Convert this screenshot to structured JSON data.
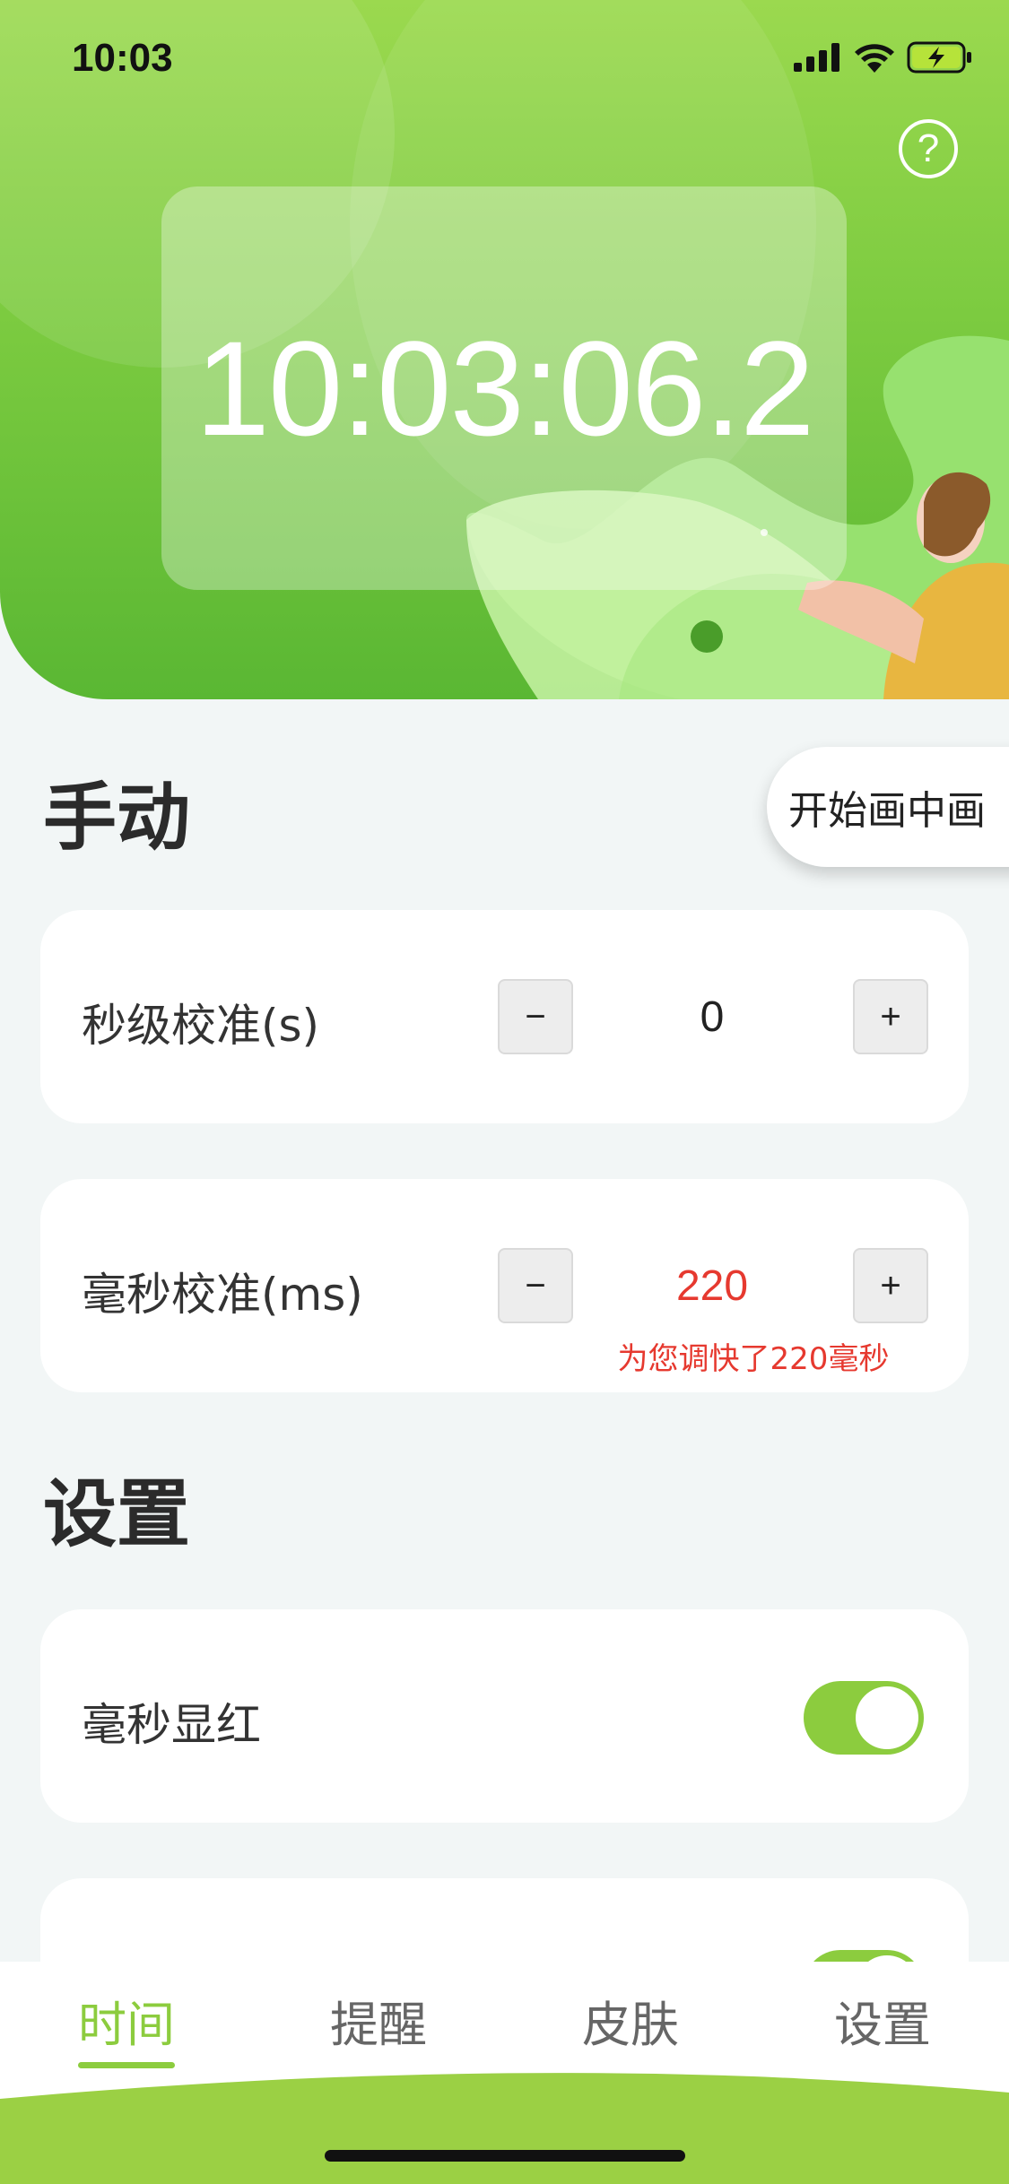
{
  "status_bar": {
    "time": "10:03"
  },
  "header": {
    "clock": "10:03:06.2",
    "help_symbol": "?"
  },
  "manual_section": {
    "title": "手动",
    "pip_button": "开始画中画",
    "seconds": {
      "label": "秒级校准(s)",
      "minus": "−",
      "value": "0",
      "plus": "+"
    },
    "milliseconds": {
      "label": "毫秒校准(ms)",
      "minus": "−",
      "value": "220",
      "plus": "+",
      "hint": "为您调快了220毫秒"
    }
  },
  "settings_section": {
    "title": "设置",
    "ms_red": {
      "label": "毫秒显红",
      "on": true
    },
    "next_toggle": {
      "on": true
    }
  },
  "tabs": [
    {
      "label": "时间",
      "active": true
    },
    {
      "label": "提醒",
      "active": false
    },
    {
      "label": "皮肤",
      "active": false
    },
    {
      "label": "设置",
      "active": false
    }
  ],
  "colors": {
    "accent": "#8ccc3e",
    "red": "#e6392f",
    "hero_green": "#6cc33b"
  }
}
